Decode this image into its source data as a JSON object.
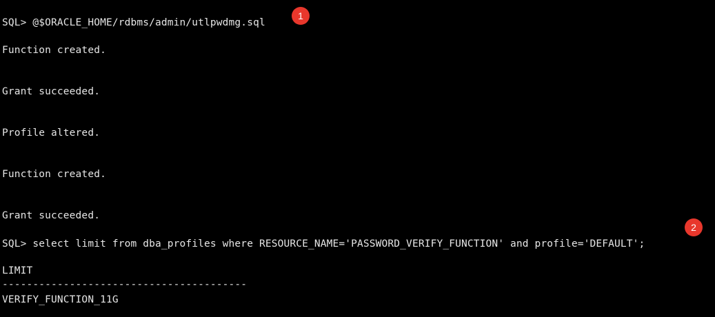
{
  "terminal": {
    "lines": [
      "SQL> @$ORACLE_HOME/rdbms/admin/utlpwdmg.sql",
      "Function created.",
      "Grant succeeded.",
      "Profile altered.",
      "Function created.",
      "Grant succeeded.",
      "SQL> select limit from dba_profiles where RESOURCE_NAME='PASSWORD_VERIFY_FUNCTION' and profile='DEFAULT';",
      "LIMIT",
      "----------------------------------------",
      "VERIFY_FUNCTION_11G"
    ]
  },
  "annotations": {
    "marker1": "1",
    "marker2": "2"
  },
  "colors": {
    "background": "#000000",
    "text": "#e6e6e6",
    "marker": "#e8372c"
  }
}
